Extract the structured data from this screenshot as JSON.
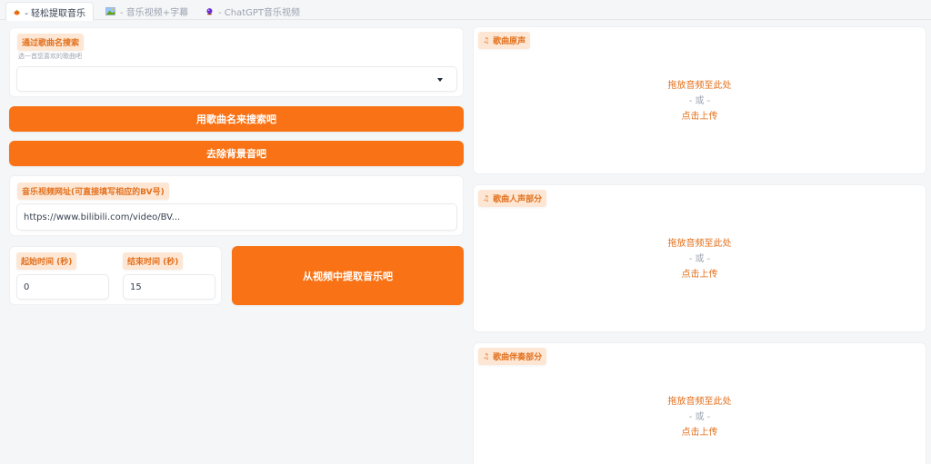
{
  "tabs": [
    {
      "label": "- 轻松提取音乐",
      "icon": "pumpkin-icon"
    },
    {
      "label": "- 音乐视频+字幕",
      "icon": "image-icon"
    },
    {
      "label": "- ChatGPT音乐视频",
      "icon": "crystal-ball-icon"
    }
  ],
  "search": {
    "label": "通过歌曲名搜索",
    "hint": "选一首您喜欢的歌曲吧",
    "selected": ""
  },
  "buttons": {
    "search_by_name": "用歌曲名来搜索吧",
    "remove_background": "去除背景音吧",
    "extract_from_video": "从视频中提取音乐吧"
  },
  "video_url": {
    "label": "音乐视频网址(可直接填写相应的BV号)",
    "value": "https://www.bilibili.com/video/BV..."
  },
  "start_time": {
    "label": "起始时间 (秒)",
    "value": "0"
  },
  "end_time": {
    "label": "结束时间 (秒)",
    "value": "15"
  },
  "audio_panels": [
    {
      "label": "歌曲原声",
      "drop_text": "拖放音频至此处",
      "or_text": "- 或 -",
      "upload_text": "点击上传"
    },
    {
      "label": "歌曲人声部分",
      "drop_text": "拖放音频至此处",
      "or_text": "- 或 -",
      "upload_text": "点击上传"
    },
    {
      "label": "歌曲伴奏部分",
      "drop_text": "拖放音频至此处",
      "or_text": "- 或 -",
      "upload_text": "点击上传"
    }
  ],
  "colors": {
    "accent": "#f97316",
    "label_bg": "#fde7d4",
    "label_text": "#e2701d",
    "background": "#f5f6f8"
  }
}
